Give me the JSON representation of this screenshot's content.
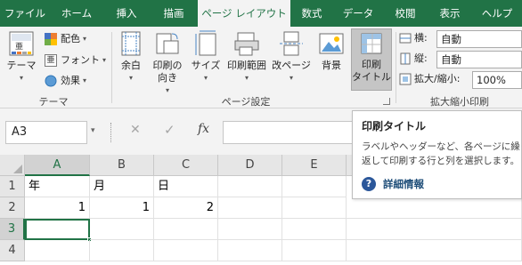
{
  "tabs": [
    "ファイル",
    "ホーム",
    "挿入",
    "描画",
    "ページ レイアウト",
    "数式",
    "データ",
    "校閲",
    "表示",
    "ヘルプ"
  ],
  "ribbon": {
    "theme_label": "テーマ",
    "colors_label": "配色",
    "fonts_label": "フォント",
    "effects_label": "効果",
    "group_theme": "テーマ",
    "margins_label": "余白",
    "orientation_label_1": "印刷の",
    "orientation_label_2": "向き",
    "size_label": "サイズ",
    "print_area_label": "印刷範囲",
    "breaks_label": "改ページ",
    "background_label": "背景",
    "print_titles_label_1": "印刷",
    "print_titles_label_2": "タイトル",
    "group_page_setup": "ページ設定",
    "width_label": "横:",
    "width_value": "自動",
    "height_label": "縦:",
    "height_value": "自動",
    "scale_label": "拡大/縮小:",
    "scale_value": "100%",
    "group_scale": "拡大縮小印刷"
  },
  "formula_bar": {
    "name_box": "A3",
    "cancel": "✕",
    "enter": "✓",
    "fx": "fx"
  },
  "grid": {
    "columns": [
      "A",
      "B",
      "C",
      "D",
      "E"
    ],
    "rows": [
      "1",
      "2",
      "3",
      "4"
    ],
    "cells": {
      "A1": "年",
      "B1": "月",
      "C1": "日",
      "A2": "1",
      "B2": "1",
      "C2": "2"
    }
  },
  "tooltip": {
    "title": "印刷タイトル",
    "body_1": "ラベルやヘッダーなど、各ページに繰り",
    "body_2": "返して印刷する行と列を選択します。",
    "link": "詳細情報"
  },
  "colors": {
    "accent": "#217346",
    "selection": "#217346"
  }
}
